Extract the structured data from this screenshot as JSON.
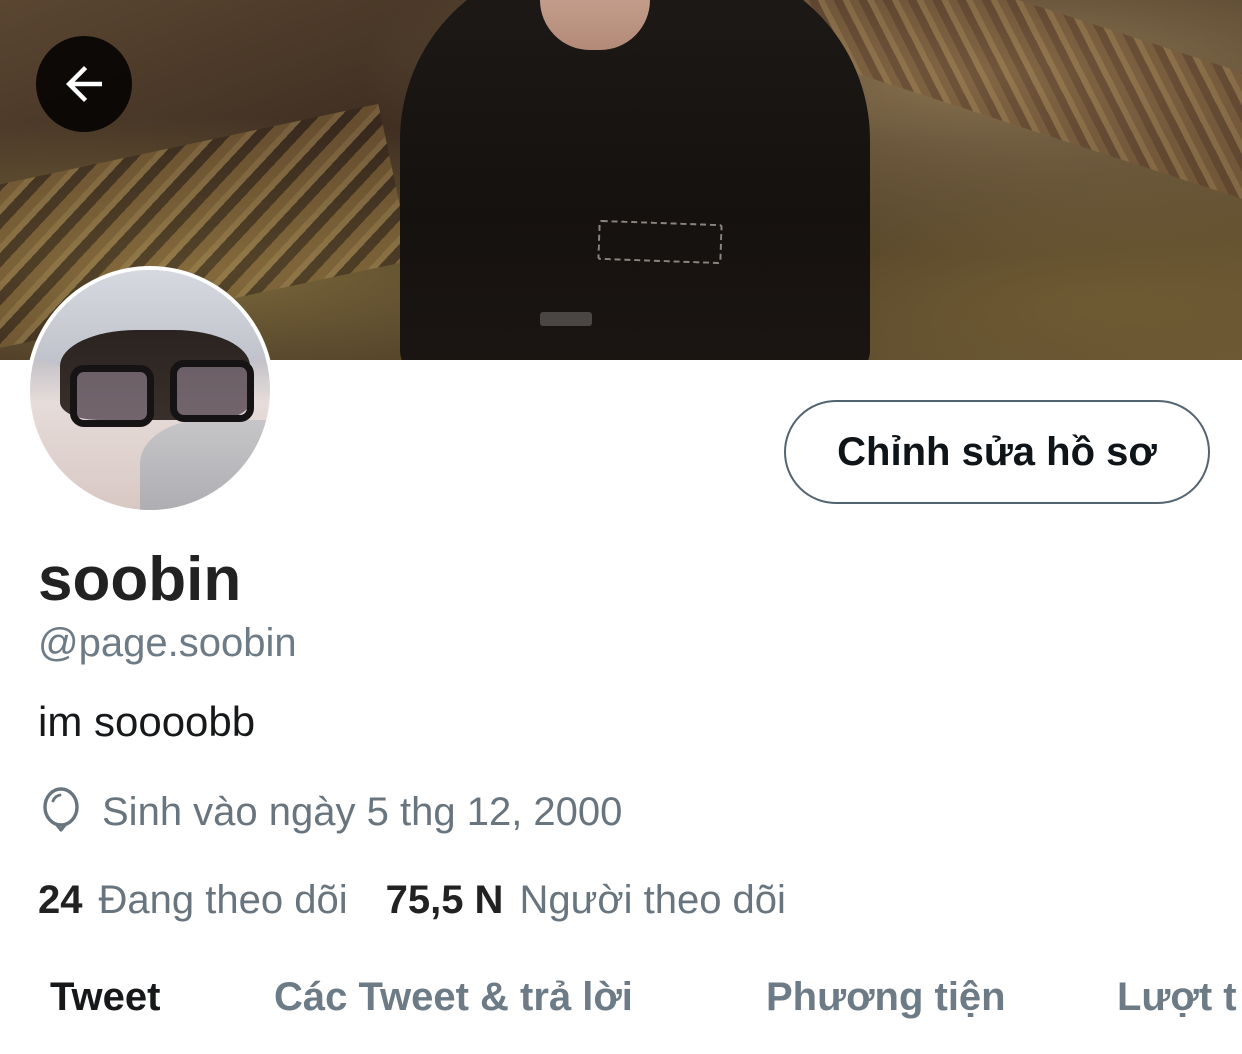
{
  "header": {
    "back_icon": "arrow-left-icon"
  },
  "profile": {
    "edit_button_label": "Chỉnh sửa hồ sơ",
    "display_name": "soobin",
    "handle": "@page.soobin",
    "bio": "im soooobb",
    "birthday_icon": "balloon-icon",
    "birthday_text": "Sinh vào ngày 5 thg 12, 2000",
    "following_count": "24",
    "following_label": "Đang theo dõi",
    "followers_count": "75,5 N",
    "followers_label": "Người theo dõi"
  },
  "tabs": [
    {
      "label": "Tweet",
      "active": true
    },
    {
      "label": "Các Tweet & trả lời",
      "active": false
    },
    {
      "label": "Phương tiện",
      "active": false
    },
    {
      "label": "Lượt t",
      "active": false
    }
  ],
  "colors": {
    "primary_text": "#0f1419",
    "secondary_text": "#68757f",
    "button_border": "#536471",
    "back_button_bg": "#000000"
  }
}
